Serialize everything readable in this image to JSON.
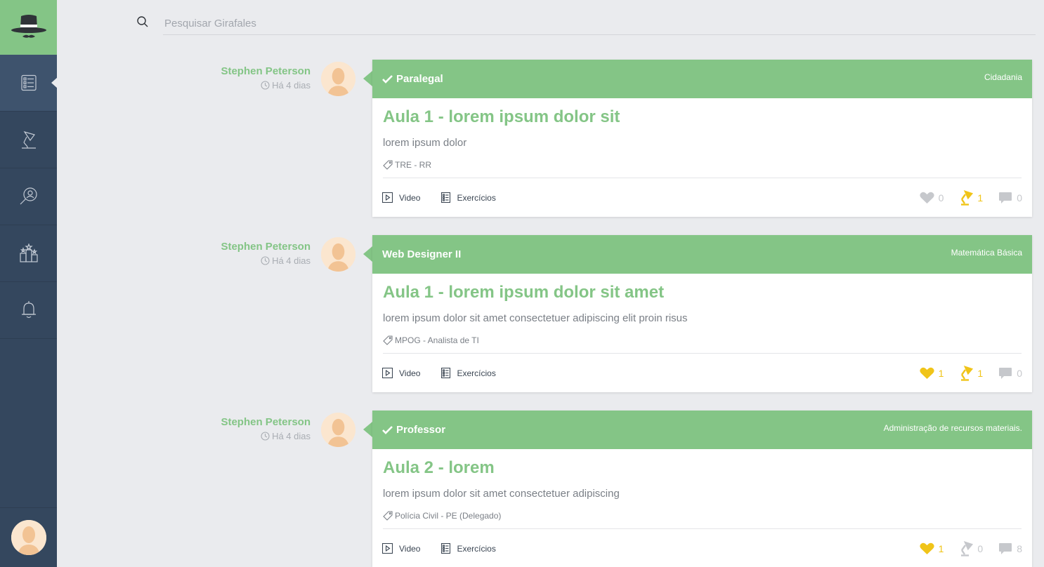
{
  "colors": {
    "brand_green": "#84c586",
    "sidebar_bg": "#34475e",
    "active_gold": "#f0c419",
    "inactive_gray": "#c6c8cc"
  },
  "sidebar": {
    "logo_icon": "spy-hat-icon",
    "items": [
      {
        "icon": "list-icon",
        "active": true
      },
      {
        "icon": "desk-lamp-icon",
        "active": false
      },
      {
        "icon": "search-user-icon",
        "active": false
      },
      {
        "icon": "ranking-podium-icon",
        "active": false
      },
      {
        "icon": "bell-icon",
        "active": false
      }
    ],
    "user_avatar_icon": "user-avatar-icon"
  },
  "search": {
    "placeholder": "Pesquisar Girafales"
  },
  "posts": [
    {
      "author": "Stephen Peterson",
      "time": "Há 4 dias",
      "verified": true,
      "channel": "Paralegal",
      "category": "Cidadania",
      "title": "Aula 1 - lorem ipsum dolor sit",
      "description": "lorem ipsum dolor",
      "tag": "TRE - RR",
      "video_label": "Video",
      "exercises_label": "Exercícios",
      "likes": "0",
      "likes_on": false,
      "lamps": "1",
      "lamps_on": true,
      "comments": "0"
    },
    {
      "author": "Stephen Peterson",
      "time": "Há 4 dias",
      "verified": false,
      "channel": "Web Designer II",
      "category": "Matemática Básica",
      "title": "Aula 1 - lorem ipsum dolor sit amet",
      "description": "lorem ipsum dolor sit amet consectetuer adipiscing elit proin risus",
      "tag": "MPOG - Analista de TI",
      "video_label": "Video",
      "exercises_label": "Exercícios",
      "likes": "1",
      "likes_on": true,
      "lamps": "1",
      "lamps_on": true,
      "comments": "0"
    },
    {
      "author": "Stephen Peterson",
      "time": "Há 4 dias",
      "verified": true,
      "channel": "Professor",
      "category": "Administração de recursos materiais.",
      "title": "Aula 2 - lorem",
      "description": "lorem ipsum dolor sit amet consectetuer adipiscing",
      "tag": "Polícia Civil - PE (Delegado)",
      "video_label": "Video",
      "exercises_label": "Exercícios",
      "likes": "1",
      "likes_on": true,
      "lamps": "0",
      "lamps_on": false,
      "comments": "8"
    }
  ]
}
